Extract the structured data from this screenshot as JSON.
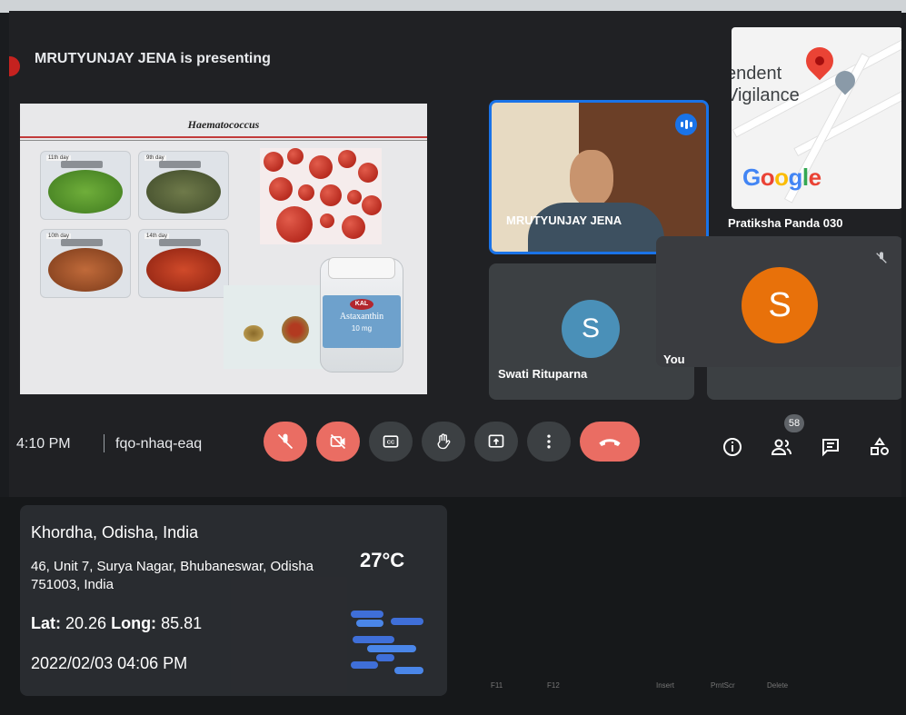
{
  "meeting": {
    "presenting_text": "MRUTYUNJAY JENA is presenting",
    "time": "4:10 PM",
    "meeting_code": "fqo-nhaq-eaq",
    "participant_count": "58"
  },
  "slide": {
    "title": "Haematococcus",
    "day_labels": [
      "11th day",
      "9th day",
      "10th day",
      "14th day"
    ],
    "bottle_brand": "KAL",
    "bottle_name": "Astaxanthin",
    "bottle_dose": "10 mg"
  },
  "participants": {
    "speaker": "MRUTYUNJAY JENA",
    "map_participant": "Pratiksha Panda 030",
    "swati": {
      "name": "Swati Rituparna",
      "initial": "S",
      "color": "#4a90b8"
    },
    "you": {
      "name": "You",
      "initial": "S",
      "color": "#e8710a"
    }
  },
  "map": {
    "text_line1": "endent",
    "text_line2": "Vigilance",
    "logo": "Google",
    "pin_icon": "map-pin-icon"
  },
  "controls": {
    "buttons": [
      "mic-off-icon",
      "camera-off-icon",
      "captions-icon",
      "raise-hand-icon",
      "present-icon",
      "more-vert-icon",
      "hang-up-icon"
    ],
    "right_icons": [
      "info-icon",
      "people-icon",
      "chat-icon",
      "activities-icon"
    ],
    "accent_red": "#ea6d63",
    "bar_grey": "#3c4043"
  },
  "overlay": {
    "place": "Khordha, Odisha, India",
    "address": "46, Unit 7, Surya Nagar, Bhubaneswar, Odisha 751003, India",
    "lat_label": "Lat:",
    "lat": "20.26",
    "long_label": "Long:",
    "long": "85.81",
    "temperature": "27°C",
    "datetime": "2022/02/03 04:06 PM",
    "weather_icon": "haze-icon"
  },
  "keyboard": {
    "keys": [
      "F11",
      "F12",
      "Insert",
      "PrntScr",
      "Delete"
    ]
  }
}
